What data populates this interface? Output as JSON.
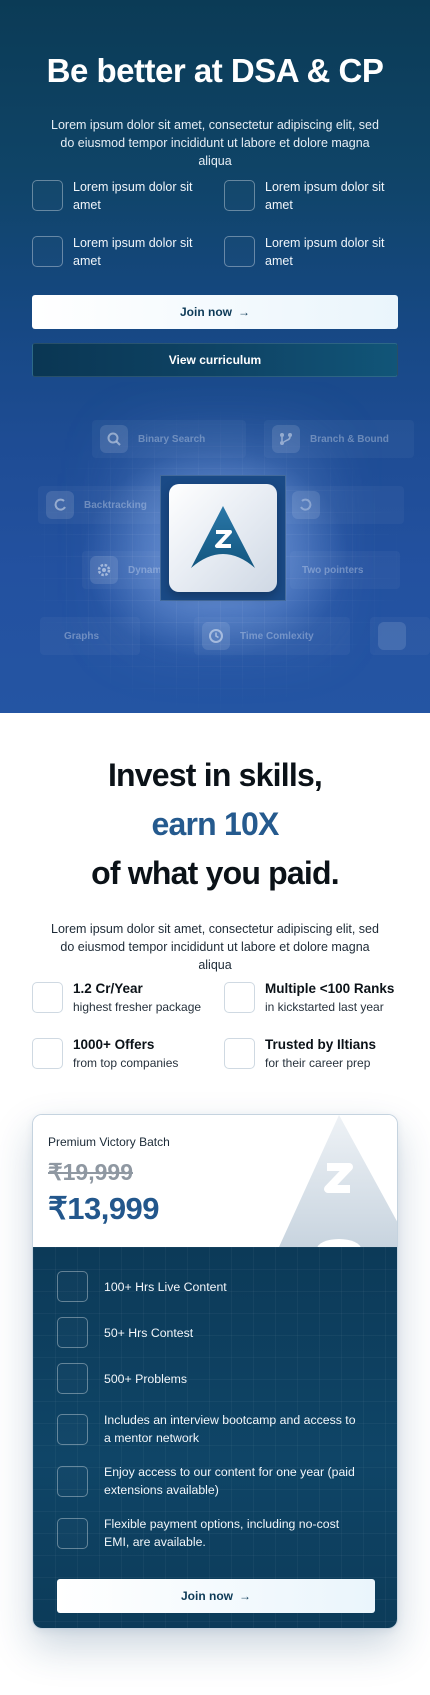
{
  "hero": {
    "title": "Be better at DSA & CP",
    "subtitle": "Lorem ipsum dolor sit amet, consectetur adipiscing elit, sed do eiusmod tempor incididunt ut labore et dolore magna aliqua",
    "features": [
      "Lorem ipsum dolor sit amet",
      "Lorem ipsum dolor sit amet",
      "Lorem ipsum dolor sit amet",
      "Lorem ipsum dolor sit amet"
    ],
    "join_label": "Join now",
    "arrow": "→",
    "curriculum_label": "View curriculum",
    "topics": [
      "Binary Search",
      "Branch & Bound",
      "Backtracking",
      "Dynamic",
      "Two pointers",
      "Graphs",
      "Time Comlexity"
    ],
    "logo_letter": "Z"
  },
  "invest": {
    "line1": "Invest in skills,",
    "line2": "earn 10X",
    "line3": "of what you paid.",
    "subtitle": "Lorem ipsum dolor sit amet, consectetur adipiscing elit, sed do eiusmod tempor incididunt ut labore et dolore magna aliqua",
    "stats": [
      {
        "title": "1.2 Cr/Year",
        "sub": "highest fresher package"
      },
      {
        "title": "Multiple <100 Ranks",
        "sub": "in kickstarted last year"
      },
      {
        "title": "1000+ Offers",
        "sub": "from top companies"
      },
      {
        "title": "Trusted by Iltians",
        "sub": "for their career prep"
      }
    ]
  },
  "pricing": {
    "batch_name": "Premium Victory Batch",
    "old_price": "₹19,999",
    "price": "₹13,999",
    "perks": [
      "100+ Hrs Live Content",
      "50+ Hrs Contest",
      "500+ Problems",
      "Includes an interview bootcamp and access to a mentor network",
      "Enjoy access to our content for one year (paid extensions available)",
      "Flexible payment options, including no-cost EMI, are available."
    ],
    "join_label": "Join now",
    "arrow": "→"
  },
  "colors": {
    "hero_dark": "#0b3b56",
    "hero_blue": "#2455a3",
    "accent_blue": "#255a8e",
    "card_dark": "#0f4567"
  },
  "icons": [
    "search-icon",
    "branch-icon",
    "backtrack-icon",
    "gear-icon",
    "clock-icon",
    "arrow-right-icon",
    "logo-icon"
  ]
}
